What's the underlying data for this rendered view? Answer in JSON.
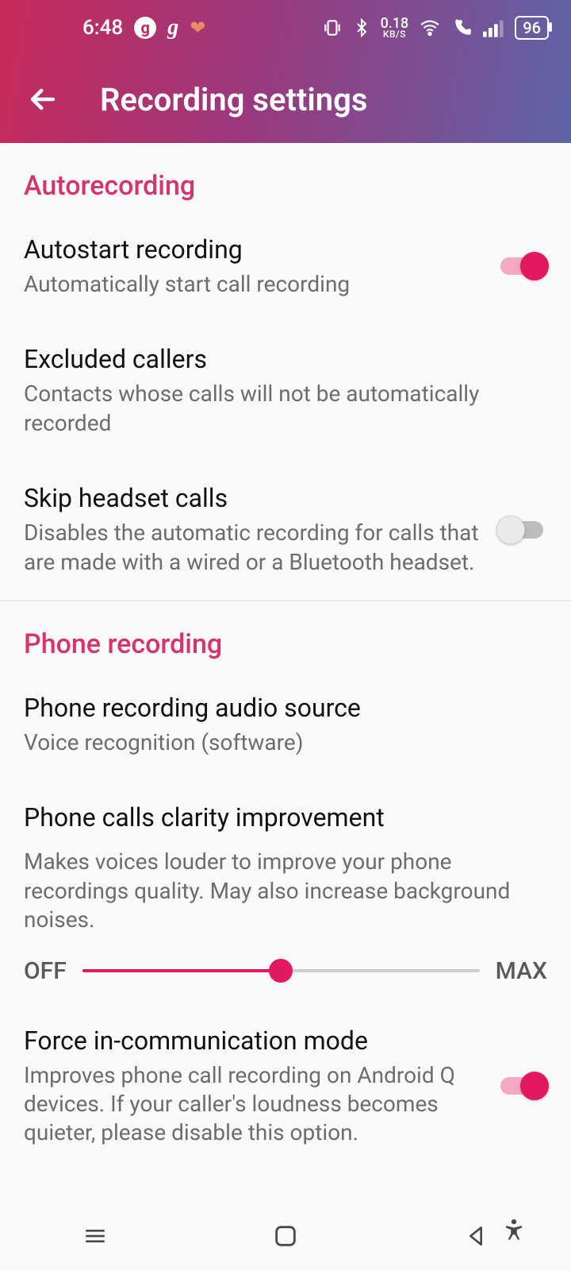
{
  "status": {
    "time": "6:48",
    "net_rate_value": "0.18",
    "net_rate_unit": "KB/S",
    "battery": "96"
  },
  "header": {
    "title": "Recording settings"
  },
  "sections": {
    "autorecording": {
      "header": "Autorecording",
      "autostart": {
        "title": "Autostart recording",
        "sub": "Automatically start call recording",
        "on": true
      },
      "excluded": {
        "title": "Excluded callers",
        "sub": "Contacts whose calls will not be automatically recorded"
      },
      "skip_headset": {
        "title": "Skip headset calls",
        "sub": "Disables the automatic recording for calls that are made with a wired or a Bluetooth headset.",
        "on": false
      }
    },
    "phone_recording": {
      "header": "Phone recording",
      "audio_source": {
        "title": "Phone recording audio source",
        "sub": "Voice recognition (software)"
      },
      "clarity": {
        "title": "Phone calls clarity improvement",
        "sub": "Makes voices louder to improve your phone recordings quality. May also increase background noises.",
        "min_label": "OFF",
        "max_label": "MAX",
        "value_pct": 50
      },
      "force_mode": {
        "title": "Force in-communication mode",
        "sub": "Improves phone call recording on Android Q devices. If your caller's loudness becomes quieter, please disable this option.",
        "on": true
      }
    }
  }
}
